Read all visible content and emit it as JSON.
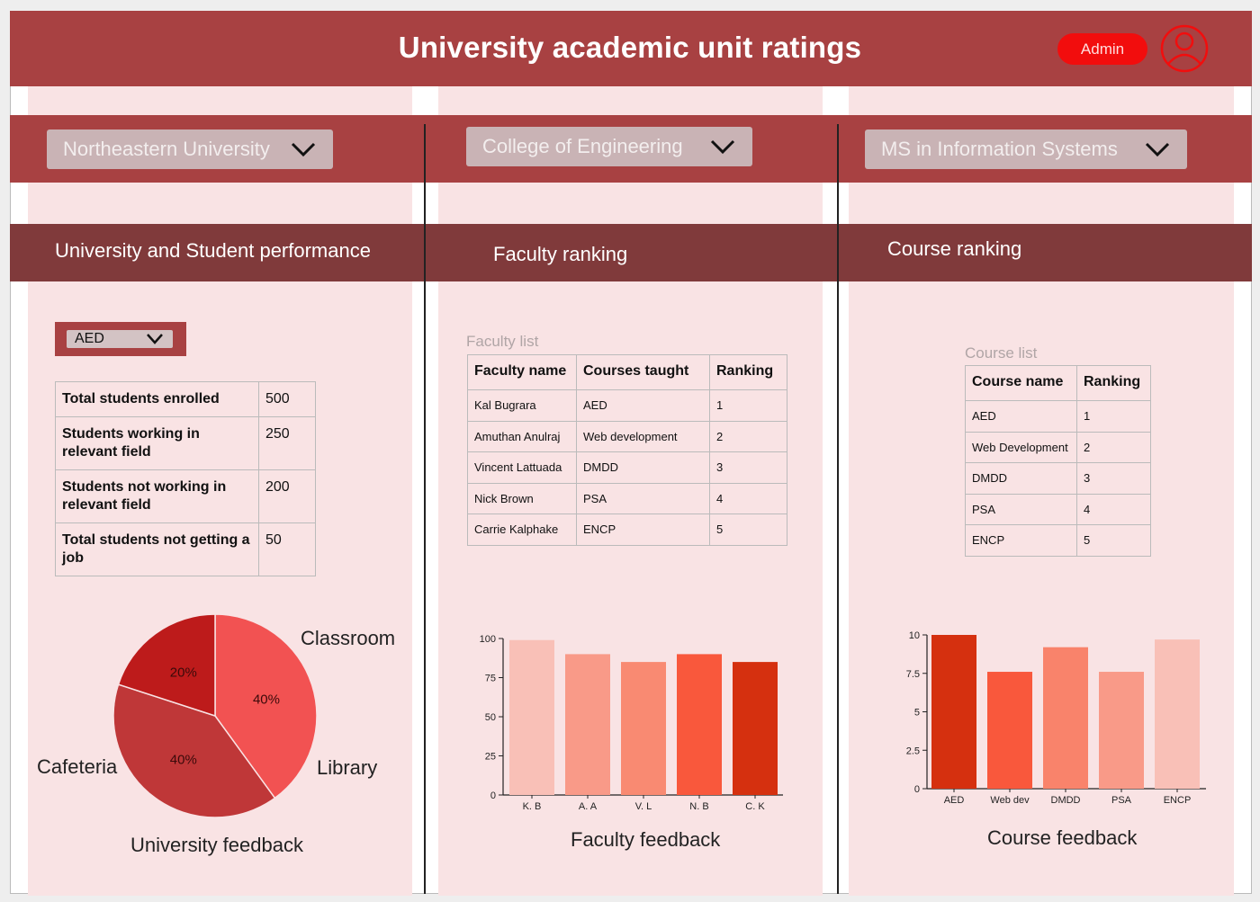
{
  "header": {
    "title": "University academic unit ratings",
    "admin_label": "Admin",
    "user_icon": "user-circle-icon"
  },
  "selectors": {
    "university": "Northeastern University",
    "college": "College of Engineering",
    "program": "MS in Information Systems"
  },
  "sections": {
    "university": "University and Student performance",
    "faculty": "Faculty ranking",
    "course": "Course ranking"
  },
  "course_filter": "AED",
  "stats": [
    {
      "label": "Total students enrolled",
      "value": "500"
    },
    {
      "label": "Students working in relevant field",
      "value": "250"
    },
    {
      "label": "Students not working in relevant field",
      "value": "200"
    },
    {
      "label": "Total students not getting a job",
      "value": "50"
    }
  ],
  "faculty_list": {
    "caption": "Faculty list",
    "headers": [
      "Faculty name",
      "Courses taught",
      "Ranking"
    ],
    "rows": [
      [
        "Kal Bugrara",
        "AED",
        "1"
      ],
      [
        "Amuthan Anulraj",
        "Web development",
        "2"
      ],
      [
        "Vincent Lattuada",
        "DMDD",
        "3"
      ],
      [
        "Nick Brown",
        "PSA",
        "4"
      ],
      [
        "Carrie Kalphake",
        "ENCP",
        "5"
      ]
    ]
  },
  "course_list": {
    "caption": "Course list",
    "headers": [
      "Course name",
      "Ranking"
    ],
    "rows": [
      [
        "AED",
        "1"
      ],
      [
        "Web Development",
        "2"
      ],
      [
        "DMDD",
        "3"
      ],
      [
        "PSA",
        "4"
      ],
      [
        "ENCP",
        "5"
      ]
    ]
  },
  "colors": {
    "header": "#a84142",
    "section_band": "#803a3b",
    "panel": "#f9e3e4",
    "admin": "#f20d0d"
  },
  "chart_data": [
    {
      "type": "pie",
      "title": "University feedback",
      "slices": [
        {
          "label": "Classroom",
          "value": 40,
          "text": "40%",
          "color": "#f25252"
        },
        {
          "label": "Library",
          "value": 40,
          "text": "40%",
          "color": "#bf3738"
        },
        {
          "label": "Cafeteria",
          "value": 20,
          "text": "20%",
          "color": "#bd1b1b"
        }
      ]
    },
    {
      "type": "bar",
      "title": "Faculty feedback",
      "categories": [
        "K. B",
        "A. A",
        "V. L",
        "N. B",
        "C. K"
      ],
      "values": [
        99,
        90,
        85,
        90,
        85
      ],
      "ylim": [
        0,
        100
      ],
      "yticks": [
        0,
        25,
        50,
        75,
        100
      ],
      "colors": [
        "#f9c0b7",
        "#f99a88",
        "#f98a72",
        "#f9583c",
        "#d5300f"
      ]
    },
    {
      "type": "bar",
      "title": "Course feedback",
      "categories": [
        "AED",
        "Web dev",
        "DMDD",
        "PSA",
        "ENCP"
      ],
      "values": [
        10,
        7.6,
        9.2,
        7.6,
        9.7
      ],
      "ylim": [
        0,
        10
      ],
      "yticks": [
        0,
        2.5,
        5,
        7.5,
        10
      ],
      "colors": [
        "#d5300f",
        "#f9583c",
        "#f9836b",
        "#f99a88",
        "#f9c0b7"
      ]
    }
  ]
}
